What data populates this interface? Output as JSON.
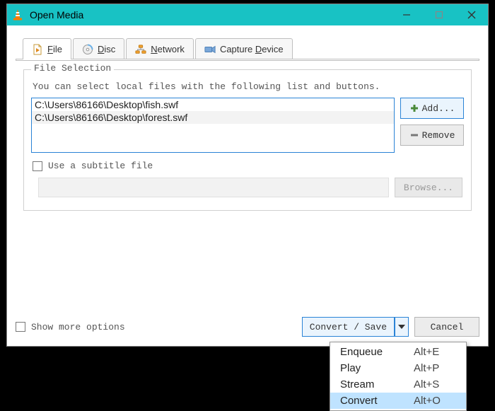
{
  "window": {
    "title": "Open Media"
  },
  "tabs": {
    "file": "File",
    "disc": "Disc",
    "network": "Network",
    "capture": "Capture Device"
  },
  "fileselection": {
    "legend": "File Selection",
    "help": "You can select local files with the following list and buttons.",
    "files": [
      "C:\\Users\\86166\\Desktop\\fish.swf",
      "C:\\Users\\86166\\Desktop\\forest.swf"
    ],
    "add_label": "Add...",
    "remove_label": "Remove"
  },
  "subtitle": {
    "checkbox_label": "Use a subtitle file",
    "browse_label": "Browse..."
  },
  "bottom": {
    "show_more": "Show more options",
    "convert_save": "Convert / Save",
    "cancel": "Cancel"
  },
  "menu": {
    "items": [
      {
        "label": "Enqueue",
        "shortcut": "Alt+E"
      },
      {
        "label": "Play",
        "shortcut": "Alt+P"
      },
      {
        "label": "Stream",
        "shortcut": "Alt+S"
      },
      {
        "label": "Convert",
        "shortcut": "Alt+O"
      }
    ],
    "selected_index": 3
  }
}
